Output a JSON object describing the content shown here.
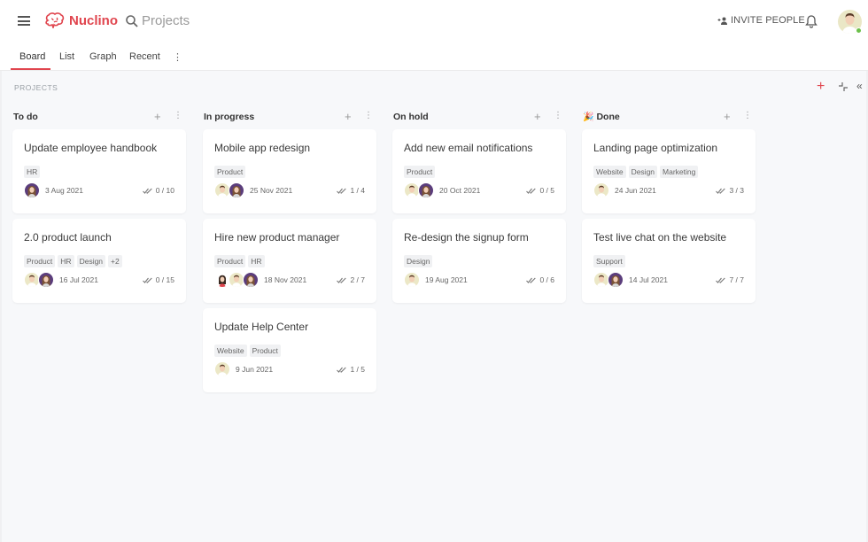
{
  "app": {
    "brand": "Nuclino",
    "brand_color": "#e0454e",
    "search_label": "Projects",
    "invite_label": "INVITE PEOPLE",
    "icons": {
      "menu": "hamburger-icon",
      "search": "search-icon",
      "invite": "add-person-icon",
      "notifications": "bell-icon",
      "avatar_status": "online"
    }
  },
  "tabs": [
    {
      "label": "Board",
      "active": true
    },
    {
      "label": "List",
      "active": false
    },
    {
      "label": "Graph",
      "active": false
    },
    {
      "label": "Recent",
      "active": false
    }
  ],
  "tabs_more": "⋮",
  "board": {
    "section_label": "PROJECTS",
    "add_icon": "+",
    "collapse_icon": "collapse-icon",
    "hide_icon": "«",
    "columns": [
      {
        "title": "To do",
        "emoji": "",
        "cards": [
          {
            "title": "Update employee handbook",
            "tags": [
              "HR"
            ],
            "avatars": [
              "woman"
            ],
            "date": "3 Aug 2021",
            "progress": "0 / 10"
          },
          {
            "title": "2.0 product launch",
            "tags": [
              "Product",
              "HR",
              "Design",
              "+2"
            ],
            "avatars": [
              "man",
              "woman"
            ],
            "date": "16 Jul 2021",
            "progress": "0 / 15"
          }
        ]
      },
      {
        "title": "In progress",
        "emoji": "",
        "cards": [
          {
            "title": "Mobile app redesign",
            "tags": [
              "Product"
            ],
            "avatars": [
              "man",
              "woman"
            ],
            "date": "25 Nov 2021",
            "progress": "1 / 4"
          },
          {
            "title": "Hire new product manager",
            "tags": [
              "Product",
              "HR"
            ],
            "avatars": [
              "girl",
              "man",
              "woman"
            ],
            "date": "18 Nov 2021",
            "progress": "2 / 7"
          },
          {
            "title": "Update Help Center",
            "tags": [
              "Website",
              "Product"
            ],
            "avatars": [
              "man"
            ],
            "date": "9 Jun 2021",
            "progress": "1 / 5"
          }
        ]
      },
      {
        "title": "On hold",
        "emoji": "",
        "cards": [
          {
            "title": "Add new email notifications",
            "tags": [
              "Product"
            ],
            "avatars": [
              "man",
              "woman"
            ],
            "date": "20 Oct 2021",
            "progress": "0 / 5"
          },
          {
            "title": "Re-design the signup form",
            "tags": [
              "Design"
            ],
            "avatars": [
              "man"
            ],
            "date": "19 Aug 2021",
            "progress": "0 / 6"
          }
        ]
      },
      {
        "title": "Done",
        "emoji": "🎉",
        "cards": [
          {
            "title": "Landing page optimization",
            "tags": [
              "Website",
              "Design",
              "Marketing"
            ],
            "avatars": [
              "man"
            ],
            "date": "24 Jun 2021",
            "progress": "3 / 3"
          },
          {
            "title": "Test live chat on the website",
            "tags": [
              "Support"
            ],
            "avatars": [
              "man",
              "woman"
            ],
            "date": "14 Jul 2021",
            "progress": "7 / 7"
          }
        ]
      }
    ]
  }
}
